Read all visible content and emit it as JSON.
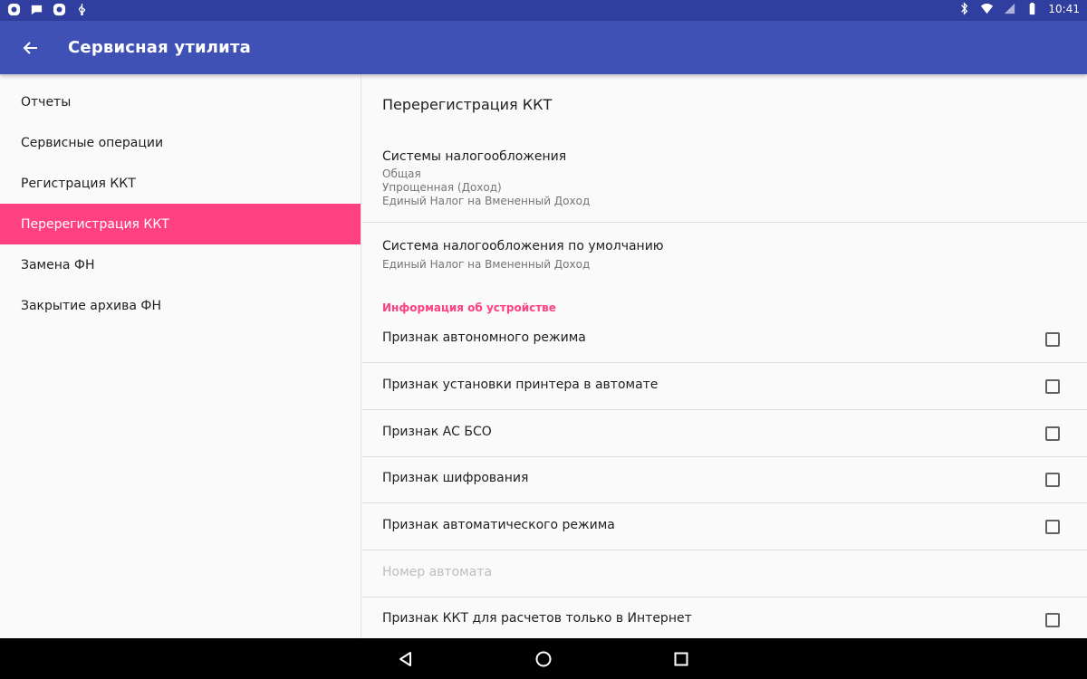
{
  "status_bar": {
    "left_icons": [
      "app-a-icon",
      "message-icon",
      "app-a-icon",
      "usb-icon"
    ],
    "right_icons": [
      "bluetooth-icon",
      "wifi-icon",
      "signal-icon",
      "battery-icon"
    ],
    "time": "10:41"
  },
  "app_bar": {
    "title": "Сервисная утилита",
    "back_icon": "arrow-back-icon",
    "color": "#3f51b5"
  },
  "menu": {
    "items": [
      {
        "label": "Отчеты"
      },
      {
        "label": "Сервисные операции"
      },
      {
        "label": "Регистрация ККТ"
      },
      {
        "label": "Перерегистрация ККТ",
        "active": true
      },
      {
        "label": "Замена ФН"
      },
      {
        "label": "Закрытие архива ФН"
      }
    ],
    "active_color": "#ff4081"
  },
  "content": {
    "heading": "Перерегистрация ККТ",
    "tax_systems": {
      "title": "Системы налогообложения",
      "summary": [
        "Общая",
        "Упрощенная (Доход)",
        "Единый Налог на Вмененный Доход"
      ]
    },
    "default_tax": {
      "title": "Система налогообложения по умолчанию",
      "summary": "Единый Налог на Вмененный Доход"
    },
    "device_info_category": "Информация об устройстве",
    "checkboxes": [
      {
        "label": "Признак автономного режима",
        "checked": false
      },
      {
        "label": "Признак установки принтера в автомате",
        "checked": false
      },
      {
        "label": "Признак АС БСО",
        "checked": false
      },
      {
        "label": "Признак шифрования",
        "checked": false
      },
      {
        "label": "Признак автоматического режима",
        "checked": false
      },
      {
        "label": "Номер автомата",
        "disabled": true
      },
      {
        "label": "Признак ККТ для расчетов только в Интернет",
        "checked": false
      }
    ]
  },
  "nav_bar": {
    "buttons": [
      "back-triangle-icon",
      "home-circle-icon",
      "recents-square-icon"
    ]
  }
}
